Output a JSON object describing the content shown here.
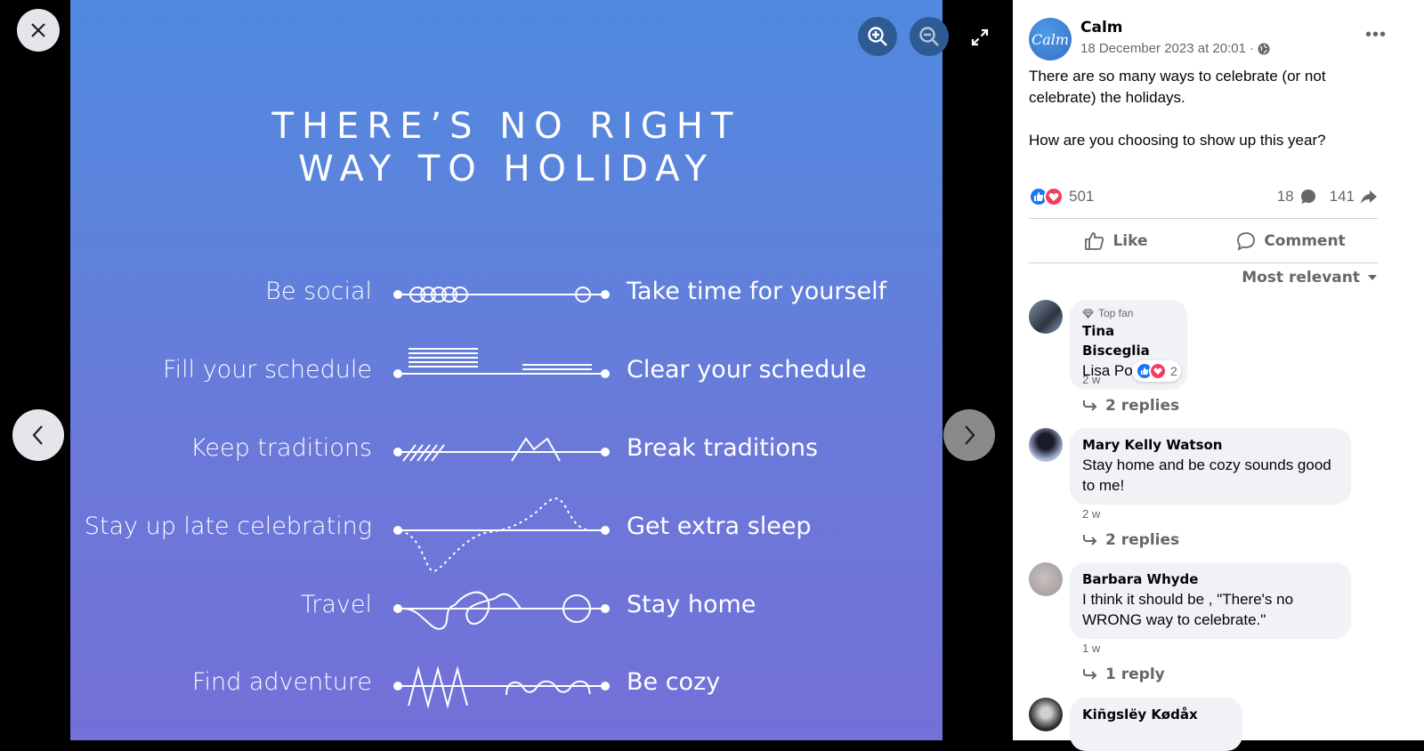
{
  "viewer": {
    "controls": {
      "close_icon": "close-icon",
      "prev_icon": "chevron-left-icon",
      "next_icon": "chevron-right-icon",
      "zoom_in_icon": "zoom-in-icon",
      "zoom_out_icon": "zoom-out-icon",
      "fullscreen_icon": "fullscreen-icon"
    },
    "photo": {
      "title_line1": "THERE’S NO RIGHT",
      "title_line2": "WAY TO HOLIDAY",
      "rows": [
        {
          "left": "Be social",
          "right": "Take time for yourself"
        },
        {
          "left": "Fill your schedule",
          "right": "Clear your schedule"
        },
        {
          "left": "Keep traditions",
          "right": "Break traditions"
        },
        {
          "left": "Stay up late celebrating",
          "right": "Get extra sleep"
        },
        {
          "left": "Travel",
          "right": "Stay home"
        },
        {
          "left": "Find adventure",
          "right": "Be cozy"
        }
      ]
    }
  },
  "post": {
    "page_name": "Calm",
    "avatar_text": "Calm",
    "timestamp": "18 December 2023 at 20:01",
    "separator": "·",
    "audience_icon": "globe-icon",
    "more_icon": "•••",
    "text": "There are so many ways to celebrate (or not celebrate) the holidays.\n\nHow are you choosing to show up this year?",
    "reactions_count": "501",
    "comments_count": "18",
    "shares_count": "141",
    "actions": {
      "like": "Like",
      "comment": "Comment"
    },
    "sort_label": "Most relevant",
    "colors": {
      "like_blue": "#1877f2",
      "love_red": "#f33e58",
      "secondary_text": "#65676b",
      "bubble_bg": "#f0f2f5"
    }
  },
  "comments": [
    {
      "badge": "Top fan",
      "author": "Tina Bisceglia",
      "text": "Lisa Powers",
      "time": "2 w",
      "reaction_count": "2",
      "replies": "2 replies"
    },
    {
      "author": "Mary Kelly Watson",
      "text": "Stay home and be cozy sounds good to me!",
      "time": "2 w",
      "replies": "2 replies"
    },
    {
      "author": "Barbara Whyde",
      "text": "I think it should be , \"There's no WRONG way to celebrate.\"",
      "time": "1 w",
      "replies": "1 reply"
    },
    {
      "author": "Kiñgslëy Kødåx"
    }
  ]
}
